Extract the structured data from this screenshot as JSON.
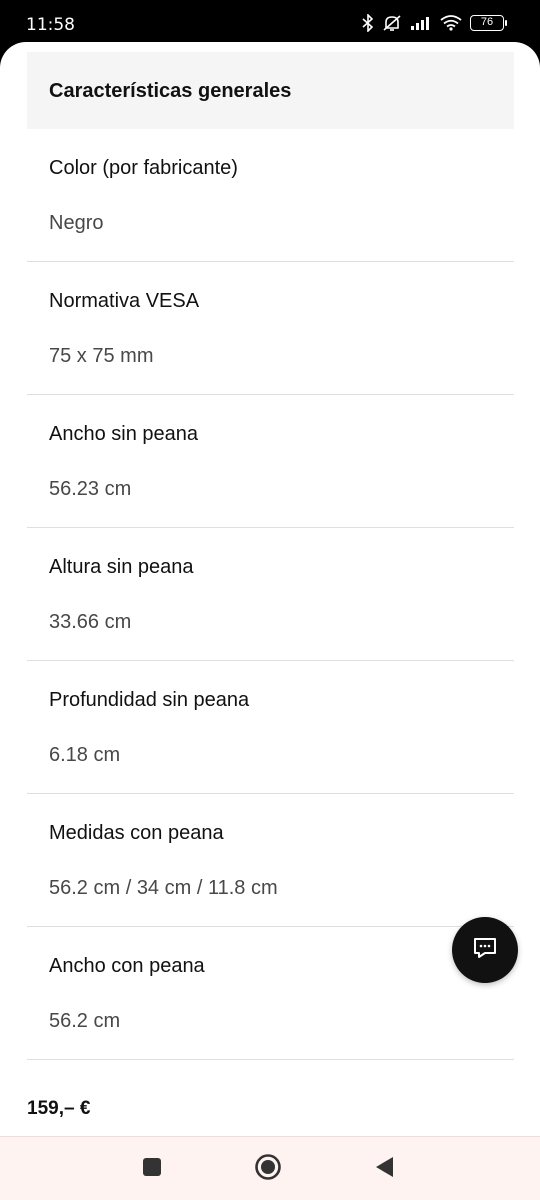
{
  "status_bar": {
    "time": "11:58",
    "battery": "76",
    "icons": [
      "bluetooth-icon",
      "mute-icon",
      "signal-icon",
      "wifi-icon",
      "battery-icon"
    ]
  },
  "section": {
    "title": "Características generales"
  },
  "specs": [
    {
      "label": "Color (por fabricante)",
      "value": "Negro"
    },
    {
      "label": "Normativa VESA",
      "value": "75 x 75 mm"
    },
    {
      "label": "Ancho sin peana",
      "value": "56.23 cm"
    },
    {
      "label": "Altura sin peana",
      "value": "33.66 cm"
    },
    {
      "label": "Profundidad sin peana",
      "value": "6.18 cm"
    },
    {
      "label": "Medidas con peana",
      "value": "56.2 cm / 34 cm / 11.8 cm"
    },
    {
      "label": "Ancho con peana",
      "value": "56.2 cm"
    }
  ],
  "chat_button": {
    "icon": "chat-icon"
  },
  "footer": {
    "price": "159,– €"
  },
  "nav": {
    "icons": [
      "recents-square-icon",
      "home-circle-icon",
      "back-triangle-icon"
    ]
  }
}
